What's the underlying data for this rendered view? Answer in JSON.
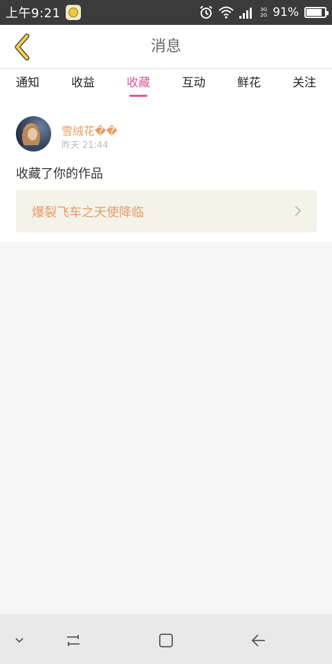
{
  "status_bar": {
    "time": "上午9:21",
    "network_top": "3G",
    "network_bottom": "2G",
    "battery_text": "91%",
    "battery_level": 0.91,
    "icons": [
      "app-icon",
      "alarm-icon",
      "wifi-icon",
      "signal-icon",
      "battery-icon"
    ]
  },
  "header": {
    "title": "消息",
    "back_icon": "chevron-left-icon",
    "accent": "#f2d34b"
  },
  "tabs": [
    {
      "label": "通知",
      "active": false
    },
    {
      "label": "收益",
      "active": false
    },
    {
      "label": "收藏",
      "active": true
    },
    {
      "label": "互动",
      "active": false
    },
    {
      "label": "鲜花",
      "active": false
    },
    {
      "label": "关注",
      "active": false
    }
  ],
  "notification": {
    "user_name": "雪绒花��",
    "timestamp": "昨天 21:44",
    "action": "收藏了你的作品",
    "work_title": "爆裂飞车之天使降临"
  },
  "colors": {
    "active_tab": "#e0569a",
    "name_orange": "#e79a63",
    "background": "#f6f6f6"
  },
  "nav_bar": {
    "icons": [
      "chevron-down-icon",
      "recent-apps-icon",
      "home-icon",
      "back-arrow-icon"
    ]
  }
}
